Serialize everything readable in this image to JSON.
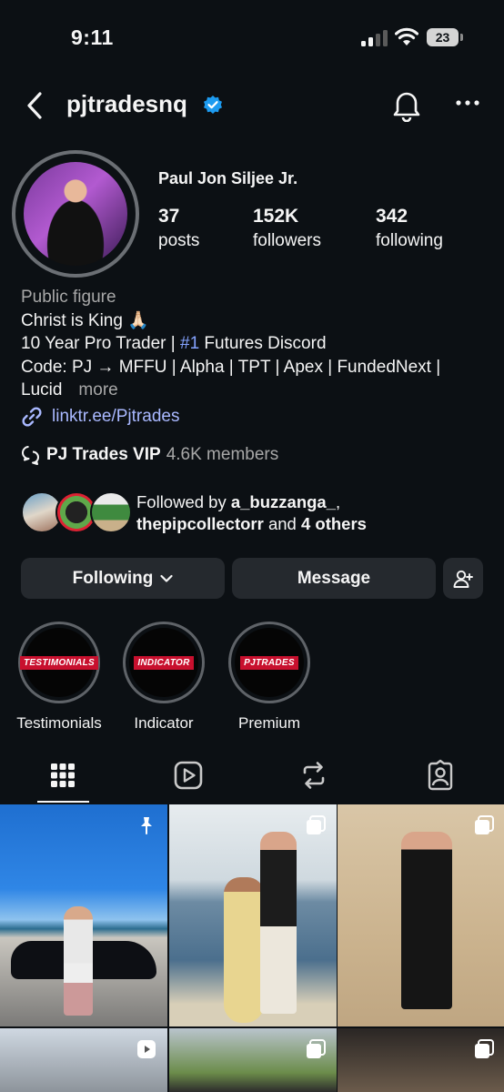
{
  "status_bar": {
    "time": "9:11",
    "battery": "23"
  },
  "header": {
    "username": "pjtradesnq",
    "verified": true
  },
  "profile": {
    "display_name": "Paul Jon Siljee Jr.",
    "stats": [
      {
        "value": "37",
        "label": "posts"
      },
      {
        "value": "152K",
        "label": "followers"
      },
      {
        "value": "342",
        "label": "following"
      }
    ],
    "category": "Public figure",
    "bio_line1": "Christ is King 🙏🏻",
    "bio_line2_pre": "10 Year Pro Trader | ",
    "bio_line2_tag": "#1",
    "bio_line2_post": " Futures Discord",
    "bio_line3": "Code: PJ → MFFU | Alpha | TPT | Apex | FundedNext |",
    "bio_line4": "Lucid",
    "more_label": "more",
    "link": "linktr.ee/Pjtrades",
    "channel_name": "PJ Trades VIP",
    "channel_members": "4.6K members",
    "followed_by_prefix": "Followed by ",
    "followed_by_user1": "a_buzzanga_",
    "followed_by_comma": ",",
    "followed_by_user2": "thepipcollectorr",
    "followed_by_and": " and ",
    "followed_by_others": "4 others"
  },
  "buttons": {
    "following": "Following",
    "message": "Message"
  },
  "highlights": [
    {
      "label": "Testimonials",
      "badge": "TESTIMONIALS"
    },
    {
      "label": "Indicator",
      "badge": "INDICATOR"
    },
    {
      "label": "Premium",
      "badge": "PJTRADES"
    }
  ],
  "tabs": [
    "grid-icon",
    "reels-icon",
    "reposts-icon",
    "tagged-icon"
  ],
  "colors": {
    "background": "#0c1014",
    "button": "#25292e",
    "link": "#a9b8ff",
    "verified": "#1d9bf0"
  }
}
